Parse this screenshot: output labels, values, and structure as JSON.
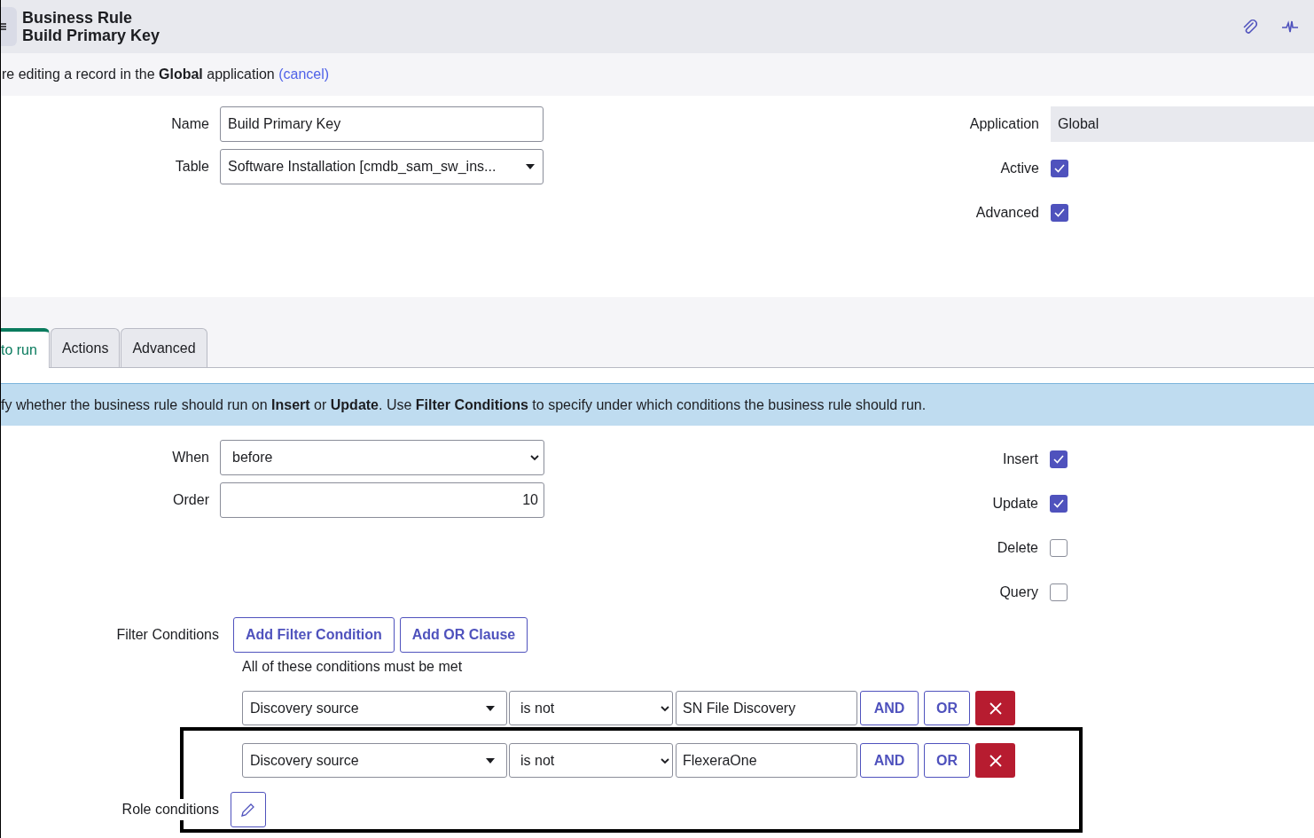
{
  "header": {
    "title": "Business Rule",
    "subtitle": "Build Primary Key"
  },
  "notice": {
    "text": "re editing a record in the **Global** application",
    "link": "(cancel)"
  },
  "fields_left": [
    {
      "label": "Name",
      "value": "Build Primary Key",
      "kind": "text"
    },
    {
      "label": "Table",
      "value": "Software Installation [cmdb_sam_sw_ins...",
      "kind": "reference"
    }
  ],
  "fields_right": [
    {
      "label": "Application",
      "value": "Global",
      "kind": "readonly"
    },
    {
      "label": "Active",
      "checked": true,
      "kind": "checkbox"
    },
    {
      "label": "Advanced",
      "checked": true,
      "kind": "checkbox"
    }
  ],
  "tabs": [
    {
      "label": "to run",
      "selected": true
    },
    {
      "label": "Actions",
      "selected": false
    },
    {
      "label": "Advanced",
      "selected": false
    }
  ],
  "info": "fy whether the business rule should run on **Insert** or **Update**. Use **Filter Conditions** to specify under which conditions the business rule should run.",
  "when_fields": [
    {
      "label": "When",
      "value": "before",
      "kind": "select"
    },
    {
      "label": "Order",
      "value": "10",
      "kind": "number"
    }
  ],
  "operations": [
    {
      "label": "Insert",
      "checked": true
    },
    {
      "label": "Update",
      "checked": true
    },
    {
      "label": "Delete",
      "checked": false
    },
    {
      "label": "Query",
      "checked": false
    }
  ],
  "filter": {
    "label": "Filter Conditions",
    "buttons": [
      "Add Filter Condition",
      "Add OR Clause"
    ],
    "note": "All of these conditions must be met",
    "conditions": [
      {
        "field": "Discovery source",
        "operator": "is not",
        "value": "SN File Discovery",
        "and": "AND",
        "or": "OR"
      },
      {
        "field": "Discovery source",
        "operator": "is not",
        "value": "FlexeraOne",
        "and": "AND",
        "or": "OR"
      }
    ]
  },
  "role_conditions": {
    "label": "Role conditions"
  },
  "annotation": {
    "shown": true
  }
}
